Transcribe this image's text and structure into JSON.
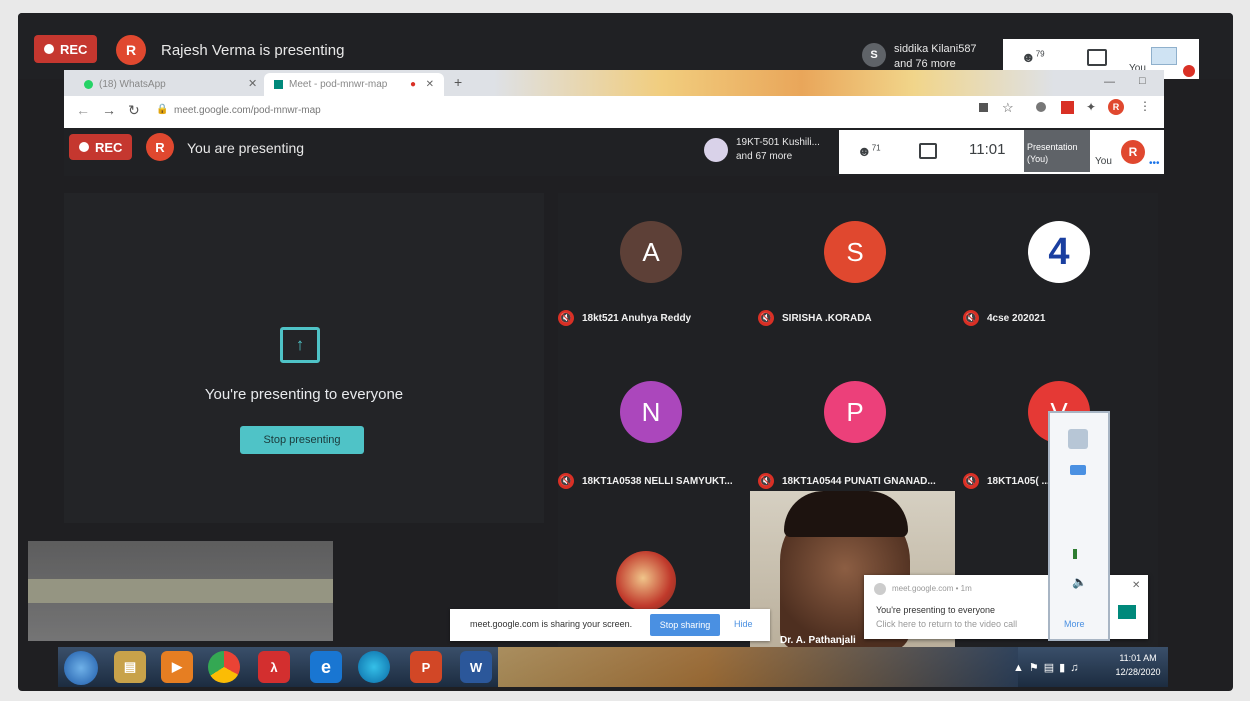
{
  "outer_bar": {
    "rec_label": "REC",
    "presenter_initial": "R",
    "presenter_text": "Rajesh Verma is presenting",
    "participant_initial": "S",
    "participant_name": "siddika Kilani587",
    "participant_more": "and 76 more",
    "people_count": "79",
    "you_label": "You"
  },
  "chrome": {
    "tab1_label": "(18) WhatsApp",
    "tab2_label": "Meet - pod-mnwr-map",
    "url": "meet.google.com/pod-mnwr-map"
  },
  "inner_bar": {
    "rec_label": "REC",
    "presenter_initial": "R",
    "presenter_text": "You are presenting",
    "participant_name": "19KT-501 Kushili...",
    "participant_more": "and 67 more",
    "people_count": "71",
    "time": "11:01",
    "presentation_label": "Presentation",
    "presentation_you": "(You)",
    "you_label": "You",
    "you_initial": "R"
  },
  "presenting_panel": {
    "message": "You're presenting to everyone",
    "stop_button": "Stop presenting"
  },
  "tiles": [
    {
      "initial": "A",
      "name": "18kt521 Anuhya Reddy",
      "color": "#5d4037"
    },
    {
      "initial": "S",
      "name": "SIRISHA .KORADA",
      "color": "#e0482f"
    },
    {
      "initial": "4",
      "name": "4cse 202021",
      "color": "#ffffff"
    },
    {
      "initial": "N",
      "name": "18KT1A0538 NELLI SAMYUKT...",
      "color": "#ab47bc"
    },
    {
      "initial": "P",
      "name": "18KT1A0544 PUNATI GNANAD...",
      "color": "#ec407a"
    },
    {
      "initial": "V",
      "name": "18KT1A05( ... AVYA...",
      "color": "#e53935"
    }
  ],
  "video_tile": {
    "name": "Dr. A. Pathanjali"
  },
  "share_bar": {
    "message": "meet.google.com is sharing your screen.",
    "stop_button": "Stop sharing",
    "hide_button": "Hide"
  },
  "notification": {
    "source": "meet.google.com • 1m",
    "title": "You're presenting to everyone",
    "body": "Click here to return to the video call"
  },
  "tray_popup": {
    "link": "More"
  },
  "taskbar": {
    "time": "11:01 AM",
    "date": "12/28/2020"
  }
}
